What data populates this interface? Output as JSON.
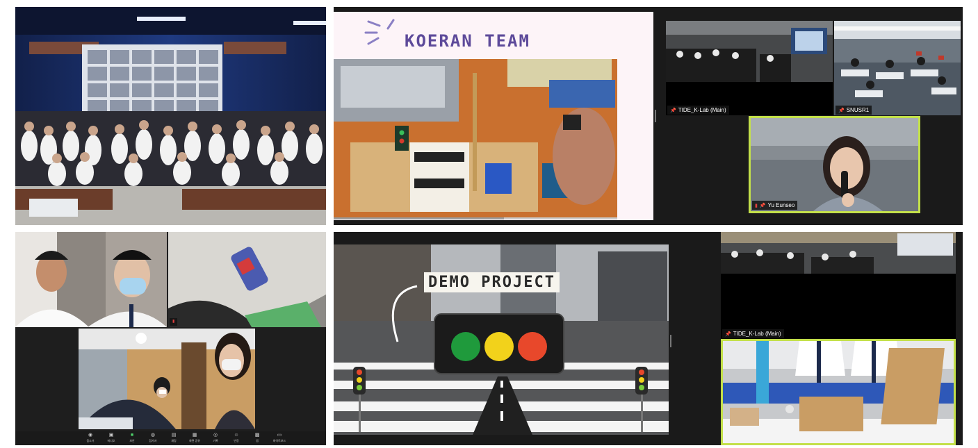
{
  "top_right": {
    "slide_title": "KOERAN TEAM",
    "participants": [
      {
        "name": "TIDE_K-Lab (Main)"
      },
      {
        "name": "SNUSR1"
      },
      {
        "name": "Yu Eunseo"
      }
    ]
  },
  "bottom_right": {
    "slide_title": "DEMO PROJECT",
    "participants": [
      {
        "name": "TIDE_K-Lab (Main)"
      }
    ],
    "traffic_light_colors": [
      "#1f9a3c",
      "#f2d21b",
      "#e8482b"
    ]
  },
  "bottom_left": {
    "toolbar": [
      "음소거",
      "비디오",
      "보안",
      "참가자",
      "채팅",
      "화면 공유",
      "기록",
      "반응",
      "앱",
      "화이트보드"
    ]
  }
}
